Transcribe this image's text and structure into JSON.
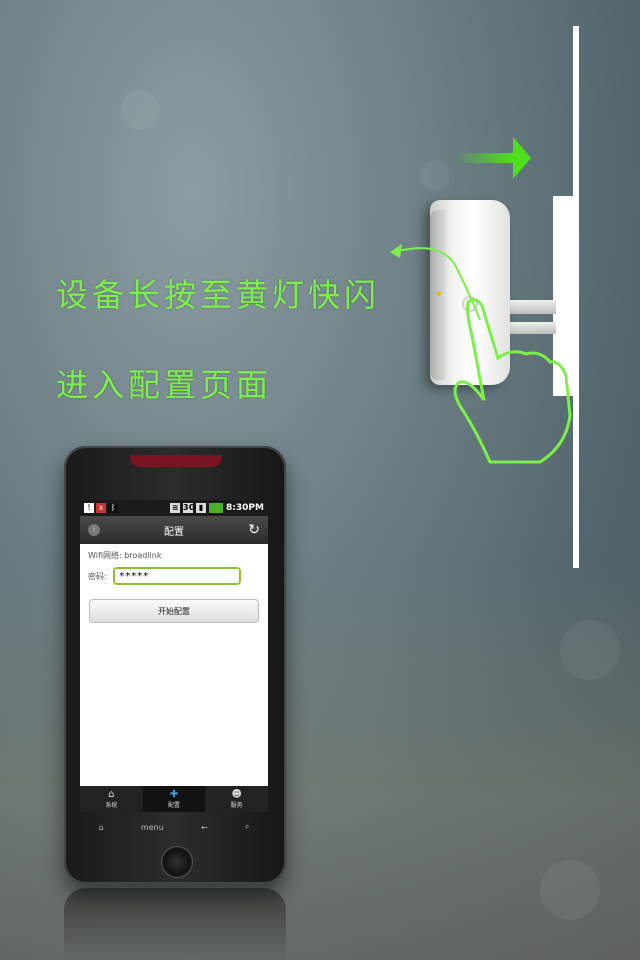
{
  "instructions": {
    "line1": "设备长按至黄灯快闪",
    "line2": "进入配置页面"
  },
  "colors": {
    "instruction_text": "#7cf04a",
    "accent_green": "#8cbf3a"
  },
  "phone": {
    "status_bar": {
      "time": "8:30PM",
      "icons": [
        "warning-icon",
        "no-signal-icon",
        "bluetooth-icon",
        "wifi-icon",
        "3g-icon",
        "signal-icon",
        "battery-icon"
      ]
    },
    "title_bar": {
      "title": "配置",
      "info_icon": "i",
      "refresh_icon": "↻"
    },
    "form": {
      "wifi_label": "Wifi网络: broadlink",
      "password_label": "密码:",
      "password_value": "*****",
      "start_button": "开始配置"
    },
    "tabs": [
      {
        "label": "系统",
        "icon": "home-icon",
        "active": false
      },
      {
        "label": "配置",
        "icon": "puzzle-icon",
        "active": true
      },
      {
        "label": "服务",
        "icon": "people-icon",
        "active": false
      }
    ],
    "soft_keys": {
      "home": "⌂",
      "menu": "menu",
      "back": "←",
      "search": "⌕"
    }
  }
}
